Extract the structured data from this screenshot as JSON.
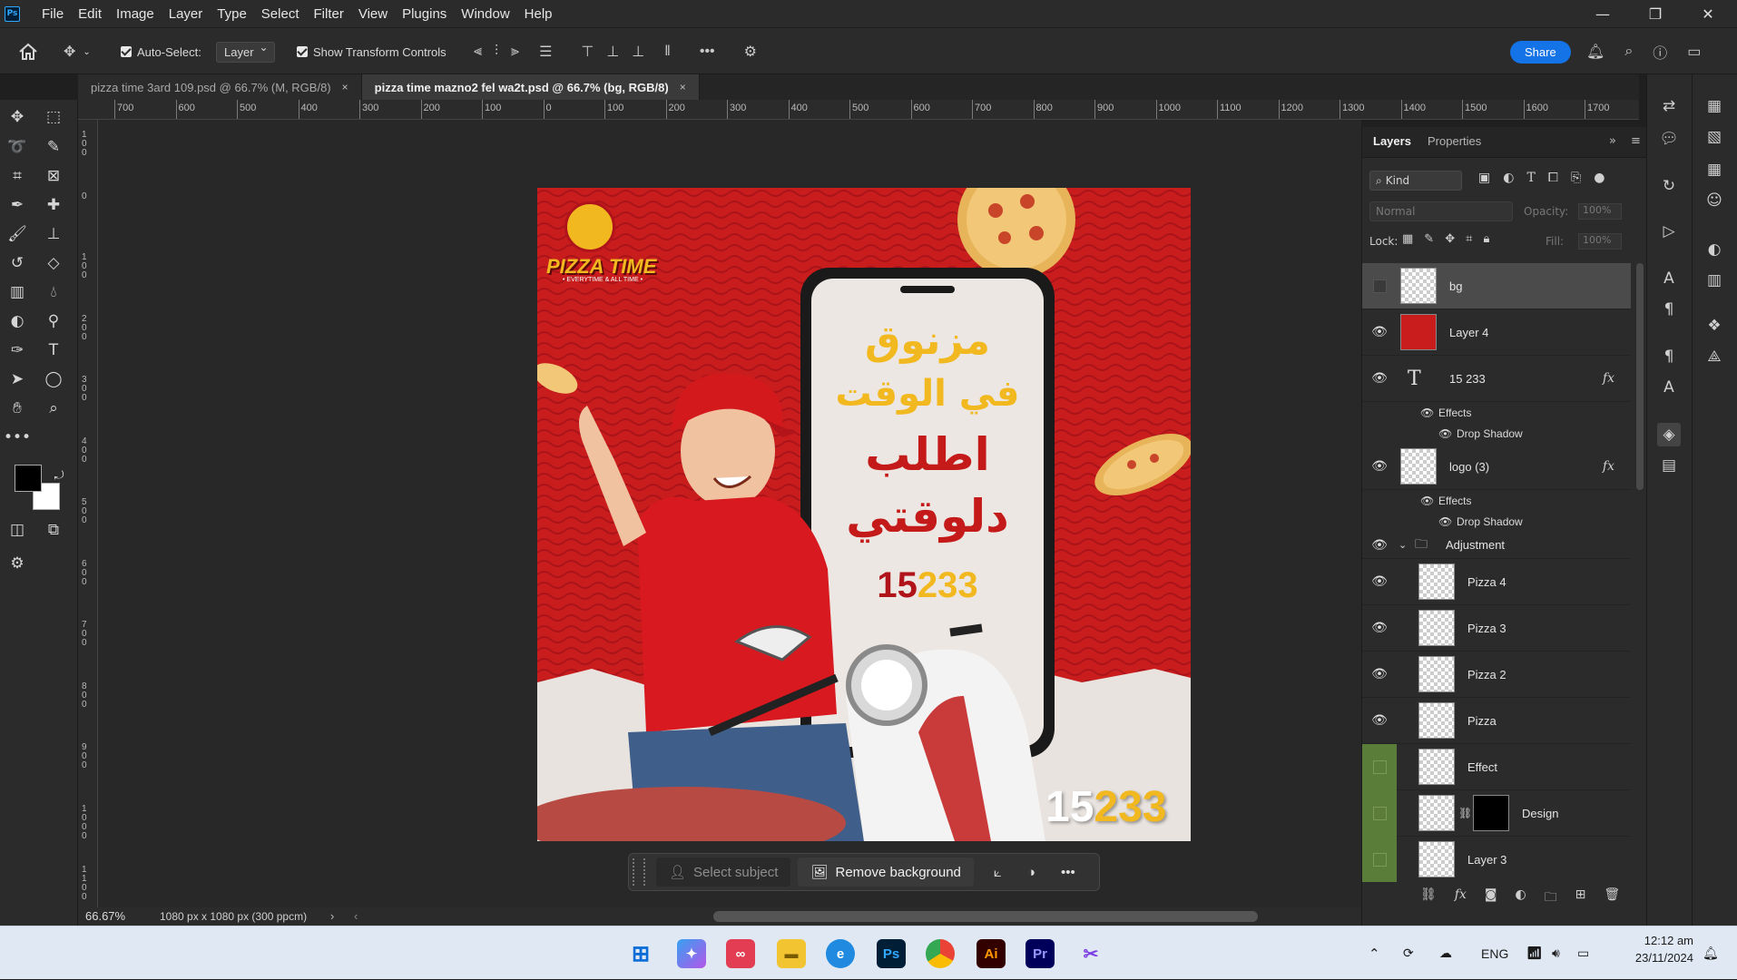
{
  "app": {
    "logo_text": "Ps",
    "menu": [
      "File",
      "Edit",
      "Image",
      "Layer",
      "Type",
      "Select",
      "Filter",
      "View",
      "Plugins",
      "Window",
      "Help"
    ],
    "window_controls": {
      "minimize": "—",
      "restore": "❐",
      "close": "✕"
    }
  },
  "options": {
    "auto_select_label": "Auto-Select:",
    "auto_select_value": "Layer",
    "show_transform_label": "Show Transform Controls",
    "share_label": "Share"
  },
  "tabs": [
    {
      "label": "pizza time 3ard 109.psd @ 66.7% (M, RGB/8)",
      "close": "×"
    },
    {
      "label": "pizza time mazno2 fel wa2t.psd @ 66.7% (bg, RGB/8)",
      "close": "×"
    }
  ],
  "ruler": {
    "h_labels": [
      "700",
      "600",
      "500",
      "400",
      "300",
      "200",
      "100",
      "0",
      "100",
      "200",
      "300",
      "400",
      "500",
      "600",
      "700",
      "800",
      "900",
      "1000",
      "1100",
      "1200",
      "1300",
      "1400",
      "1500",
      "1600",
      "1700"
    ],
    "v_labels": [
      "1 0 0",
      "0",
      "1 0 0",
      "2 0 0",
      "3 0 0",
      "4 0 0",
      "5 0 0",
      "6 0 0",
      "7 0 0",
      "8 0 0",
      "9 0 0",
      "1 0 0 0",
      "1 1 0 0"
    ]
  },
  "artwork": {
    "brand_line1": "PIZZA TIME",
    "brand_tagline": "• EVERYTIME & ALL TIME •",
    "headline1": "مزنوق",
    "headline2": "في الوقت",
    "headline3": "اطلب",
    "headline4": "دلوقتي",
    "phone_prefix": "15",
    "phone_suffix": "233",
    "colors": {
      "red": "#c41a1a",
      "yellow": "#f2b81f",
      "darkred": "#b0141a"
    }
  },
  "context_bar": {
    "select_subject": "Select subject",
    "remove_background": "Remove background",
    "more": "•••"
  },
  "status": {
    "zoom": "66.67%",
    "doc_info": "1080 px x 1080 px (300 ppcm)"
  },
  "layers_panel": {
    "tab_layers": "Layers",
    "tab_properties": "Properties",
    "filter_kind": "Kind",
    "blend_mode": "Normal",
    "opacity_label": "Opacity:",
    "opacity_value": "100%",
    "lock_label": "Lock:",
    "fill_label": "Fill:",
    "fill_value": "100%",
    "layers": [
      {
        "name": "bg"
      },
      {
        "name": "Layer 4"
      },
      {
        "name": "15 233"
      },
      {
        "name": "logo (3)"
      },
      {
        "name": "Adjustment"
      },
      {
        "name": "Pizza 4"
      },
      {
        "name": "Pizza 3"
      },
      {
        "name": "Pizza 2"
      },
      {
        "name": "Pizza"
      },
      {
        "name": "Effect"
      },
      {
        "name": "Design"
      },
      {
        "name": "Layer 3"
      }
    ],
    "effects_label": "Effects",
    "drop_shadow_label": "Drop Shadow",
    "fx_label": "fx"
  },
  "taskbar": {
    "apps": [
      "Ai",
      "Pr"
    ],
    "lang": "ENG",
    "time": "12:12 am",
    "date": "23/11/2024"
  }
}
